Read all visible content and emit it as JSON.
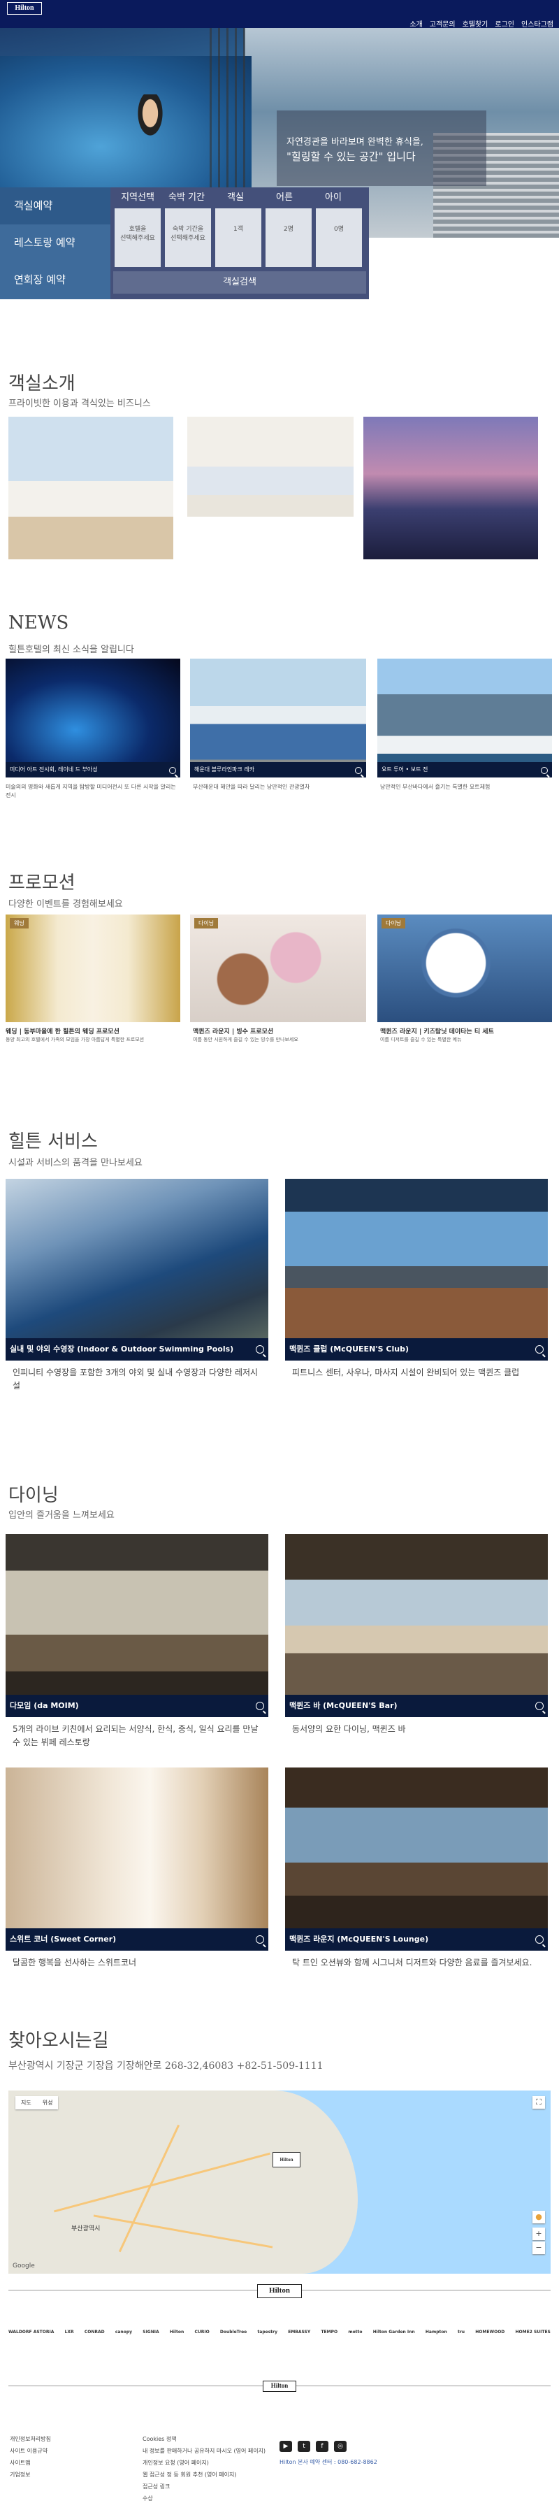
{
  "header": {
    "logo": "Hilton",
    "nav": [
      "소개",
      "고객문의",
      "호텔찾기",
      "로그인",
      "인스타그램"
    ]
  },
  "hero": {
    "caption_line1": "자연경관을 바라보며 완벽한 휴식을,",
    "caption_line2": "\"힐링할 수 있는 공간\" 입니다"
  },
  "booking": {
    "tabs": [
      "객실예약",
      "레스토랑 예약",
      "연회장 예약"
    ],
    "fields": [
      {
        "label": "지역선택",
        "value": "호텔을\n선택해주세요"
      },
      {
        "label": "숙박 기간",
        "value": "숙박 기간을\n선택해주세요"
      },
      {
        "label": "객실",
        "value": "1객"
      },
      {
        "label": "어른",
        "value": "2명"
      },
      {
        "label": "아이",
        "value": "0명"
      }
    ],
    "search_label": "객실검색"
  },
  "rooms": {
    "title": "객실소개",
    "subtitle": "프라이빗한 이용과 격식있는 비즈니스"
  },
  "news": {
    "title": "NEWS",
    "subtitle": "힐튼호텔의 최신 소식을 알립니다",
    "items": [
      {
        "caption": "미디어 아트 전시회, 레이네 드 부아성",
        "desc": "미술의의 명화와 새롭게 지역을 탐방할 미디어전시 또 다른 시작을 알리는 전시"
      },
      {
        "caption": "해운대 블루라인파크 레카",
        "desc": "부산해운대 해안을 따라 달리는 낭만적인 관광열차"
      },
      {
        "caption": "요트 투어 • 보트 전",
        "desc": "낭만적인 부산바다에서 즐기는 특별한 요트체험"
      }
    ]
  },
  "promotion": {
    "title": "프로모션",
    "subtitle": "다양한 이벤트를 경험해보세요",
    "items": [
      {
        "badge": "웨딩",
        "title": "웨딩 | 동부마을에 한 힐튼의 웨딩 프로모션",
        "desc": "동양 최고의 호텔에서 가족의 모임을 가장 아름답게 특별한 프로모션"
      },
      {
        "badge": "다이닝",
        "title": "맥퀸즈 라운지 | 빙수 프로모션",
        "desc": "여름 동안 시원하게 즐길 수 있는 빙수를 만나보세요"
      },
      {
        "badge": "다이닝",
        "title": "맥퀸즈 라운지 | 키즈탐닛 데이타는 티 세트",
        "desc": "여름 디저트를 즐길 수 있는 특별한 메뉴"
      }
    ]
  },
  "services": {
    "title": "힐튼 서비스",
    "subtitle": "시설과 서비스의 품격을 만나보세요",
    "items": [
      {
        "caption": "실내 및 야외 수영장 (Indoor & Outdoor Swimming Pools)",
        "desc": "인피니티 수영장을 포함한 3개의 야외 및 실내 수영장과 다양한 레저시설"
      },
      {
        "caption": "맥퀸즈 클럽 (McQUEEN'S Club)",
        "desc": "피트니스 센터, 사우나, 마사지 시설이 완비되어 있는 맥퀸즈 클럽"
      }
    ]
  },
  "dining": {
    "title": "다이닝",
    "subtitle": "입안의 즐거움을 느껴보세요",
    "items": [
      {
        "caption": "다모임 (da MOIM)",
        "desc": "5개의 라이브 키친에서 요리되는 서양식, 한식, 중식, 일식 요리를 만날 수 있는 뷔페 레스토랑"
      },
      {
        "caption": "맥퀸즈 바 (McQUEEN'S Bar)",
        "desc": "동서양의 요한 다이닝, 맥퀸즈 바"
      },
      {
        "caption": "스위트 코너 (Sweet Corner)",
        "desc": "달콤한 행복을 선사하는 스위트코너"
      },
      {
        "caption": "맥퀸즈 라운지 (McQUEEN'S Lounge)",
        "desc": "탁 트인 오션뷰와 함께 시그니처 디저트와 다양한 음료를 즐겨보세요."
      }
    ]
  },
  "location": {
    "title": "찾아오시는길",
    "address": "부산광역시 기장군 기장읍 기장해안로 268-32,46083 +82-51-509-1111",
    "map_tabs": [
      "지도",
      "위성"
    ],
    "pin": "Hilton",
    "city_label": "부산광역시",
    "google": "Google"
  },
  "footer": {
    "logo": "Hilton",
    "brands": [
      "WALDORF ASTORIA",
      "LXR",
      "CONRAD",
      "canopy",
      "SIGNIA",
      "Hilton",
      "CURIO",
      "DoubleTree",
      "tapestry",
      "EMBASSY",
      "TEMPO",
      "motto",
      "Hilton Garden Inn",
      "Hampton",
      "tru",
      "HOMEWOOD",
      "HOME2 SUITES"
    ],
    "col1": [
      "개인정보처리방침",
      "사이트 이용규약",
      "사이트맵",
      "기업정보"
    ],
    "col2": [
      "Cookies 정책",
      "내 정보를 판매하거나 공유하지 마시오 (영어 페이지)",
      "개인정보 요청 (영어 페이지)",
      "웹 접근성 정 등 회원 추천 (영어 페이지)",
      "접근성 링크",
      "수상"
    ],
    "social": [
      "▶",
      "t",
      "f",
      "◎"
    ],
    "hq": "Hilton 본사 예약 센터 : 080-682-8862"
  }
}
